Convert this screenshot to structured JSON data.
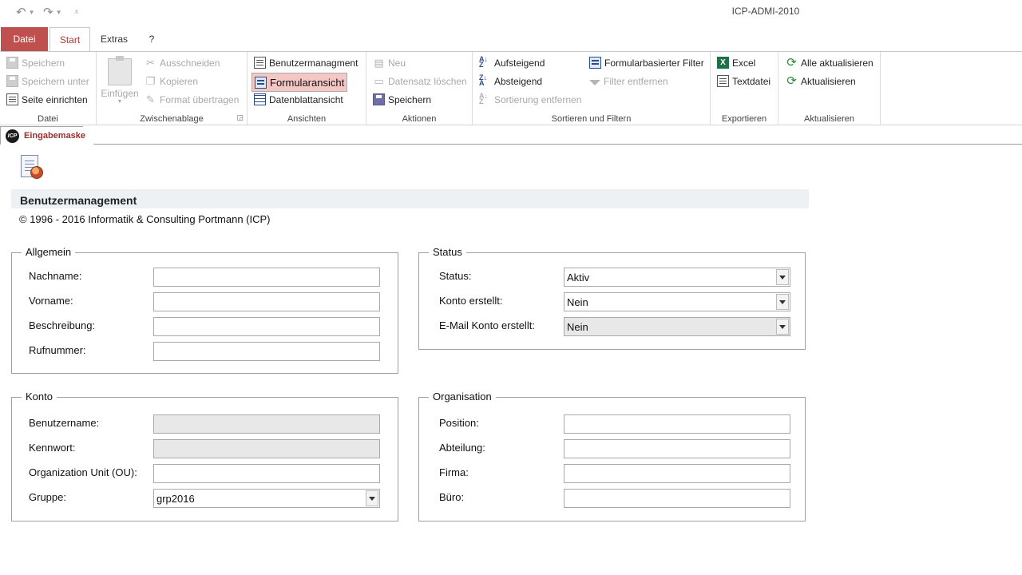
{
  "window": {
    "title": "ICP-ADMI-2010"
  },
  "qat": {
    "undo_icon": "undo-icon",
    "redo_icon": "redo-icon",
    "customize_icon": "customize-icon"
  },
  "tabs": [
    {
      "label": "Datei"
    },
    {
      "label": "Start"
    },
    {
      "label": "Extras"
    },
    {
      "label": "?"
    }
  ],
  "ribbon": {
    "datei": {
      "label": "Datei",
      "speichern": "Speichern",
      "speichern_unter": "Speichern unter",
      "seite_einrichten": "Seite einrichten"
    },
    "zwischenablage": {
      "label": "Zwischenablage",
      "einfuegen": "Einfügen",
      "ausschneiden": "Ausschneiden",
      "kopieren": "Kopieren",
      "format": "Format übertragen"
    },
    "ansichten": {
      "label": "Ansichten",
      "benutzer": "Benutzermanagment",
      "formular": "Formularansicht",
      "datenblatt": "Datenblattansicht"
    },
    "aktionen": {
      "label": "Aktionen",
      "neu": "Neu",
      "loeschen": "Datensatz löschen",
      "speichern": "Speichern"
    },
    "sortieren": {
      "label": "Sortieren und Filtern",
      "aufsteigend": "Aufsteigend",
      "absteigend": "Absteigend",
      "entfernen": "Sortierung entfernen",
      "formularfilter": "Formularbasierter Filter",
      "filter_entfernen": "Filter entfernen"
    },
    "exportieren": {
      "label": "Exportieren",
      "excel": "Excel",
      "textdatei": "Textdatei"
    },
    "aktualisieren": {
      "label": "Aktualisieren",
      "alle": "Alle aktualisieren",
      "aktualisieren": "Aktualisieren"
    }
  },
  "doc_tab": {
    "logo": "ICP",
    "label": "Eingabemaske"
  },
  "form": {
    "title": "Benutzermanagement",
    "copyright": "© 1996 - 2016 Informatik & Consulting Portmann (ICP)",
    "allgemein": {
      "legend": "Allgemein",
      "nachname_label": "Nachname:",
      "nachname_value": "",
      "vorname_label": "Vorname:",
      "vorname_value": "",
      "beschreibung_label": "Beschreibung:",
      "beschreibung_value": "",
      "rufnummer_label": "Rufnummer:",
      "rufnummer_value": ""
    },
    "status": {
      "legend": "Status",
      "status_label": "Status:",
      "status_value": "Aktiv",
      "konto_label": "Konto erstellt:",
      "konto_value": "Nein",
      "email_label": "E-Mail Konto erstellt:",
      "email_value": "Nein"
    },
    "konto": {
      "legend": "Konto",
      "benutzername_label": "Benutzername:",
      "benutzername_value": "",
      "kennwort_label": "Kennwort:",
      "kennwort_value": "",
      "ou_label": "Organization Unit (OU):",
      "ou_value": "",
      "gruppe_label": "Gruppe:",
      "gruppe_value": "grp2016"
    },
    "organisation": {
      "legend": "Organisation",
      "position_label": "Position:",
      "position_value": "",
      "abteilung_label": "Abteilung:",
      "abteilung_value": "",
      "firma_label": "Firma:",
      "firma_value": "",
      "buero_label": "Büro:",
      "buero_value": ""
    }
  },
  "colors": {
    "file_tab": "#c0504d",
    "accent": "#b03a34",
    "selected_button": "#f4c6c4"
  }
}
